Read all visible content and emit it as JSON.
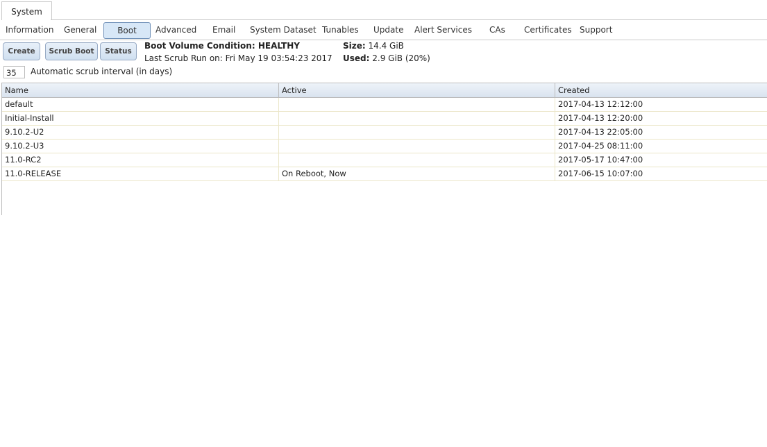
{
  "top_tab": "System",
  "sub_tabs": [
    "Information",
    "General",
    "Boot",
    "Advanced",
    "Email",
    "System Dataset",
    "Tunables",
    "Update",
    "Alert Services",
    "CAs",
    "Certificates",
    "Support"
  ],
  "buttons": {
    "create": "Create",
    "scrub": "Scrub Boot",
    "status": "Status"
  },
  "status": {
    "condition_label": "Boot Volume Condition:",
    "condition_value": "HEALTHY",
    "last_scrub": "Last Scrub Run on: Fri May 19 03:54:23 2017",
    "size_label": "Size:",
    "size_value": "14.4 GiB",
    "used_label": "Used:",
    "used_value": "2.9 GiB (20%)"
  },
  "scrub_interval": {
    "value": "35",
    "label": "Automatic scrub interval (in days)"
  },
  "table": {
    "columns": [
      "Name",
      "Active",
      "Created"
    ],
    "rows": [
      [
        "default",
        "",
        "2017-04-13 12:12:00"
      ],
      [
        "Initial-Install",
        "",
        "2017-04-13 12:20:00"
      ],
      [
        "9.10.2-U2",
        "",
        "2017-04-13 22:05:00"
      ],
      [
        "9.10.2-U3",
        "",
        "2017-04-25 08:11:00"
      ],
      [
        "11.0-RC2",
        "",
        "2017-05-17 10:47:00"
      ],
      [
        "11.0-RELEASE",
        "On Reboot, Now",
        "2017-06-15 10:07:00"
      ]
    ]
  }
}
